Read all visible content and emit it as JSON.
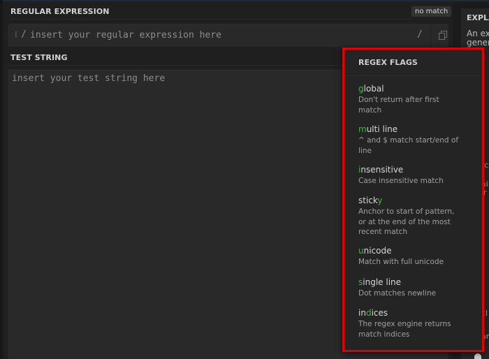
{
  "regex": {
    "label": "REGULAR EXPRESSION",
    "match_status": "no match",
    "open_delimiter": "/",
    "close_delimiter": "/",
    "flags_indicator": "⁝",
    "placeholder": "insert your regular expression here",
    "value": "",
    "copy_icon": "copy-icon"
  },
  "test_string": {
    "label": "TEST STRING",
    "placeholder": "insert your test string here",
    "value": ""
  },
  "explanation": {
    "title": "EXPLANATION",
    "text_line1": "An ex",
    "text_line2": "gener",
    "fragments": [
      "rc",
      "ai",
      "ır",
      "cl",
      "ar"
    ]
  },
  "flags_menu": {
    "title": "REGEX FLAGS",
    "highlight_color": "#4caf50",
    "items": [
      {
        "pre": "",
        "key": "g",
        "post": "lobal",
        "description": "Don't return after first match"
      },
      {
        "pre": "",
        "key": "m",
        "post": "ulti line",
        "description": "^ and $ match start/end of line"
      },
      {
        "pre": "",
        "key": "i",
        "post": "nsensitive",
        "description": "Case insensitive match"
      },
      {
        "pre": "stick",
        "key": "y",
        "post": "",
        "description": "Anchor to start of pattern, or at the end of the most recent match"
      },
      {
        "pre": "",
        "key": "u",
        "post": "nicode",
        "description": "Match with full unicode"
      },
      {
        "pre": "",
        "key": "s",
        "post": "ingle line",
        "description": "Dot matches newline"
      },
      {
        "pre": "in",
        "key": "d",
        "post": "ices",
        "description": "The regex engine returns match indices"
      }
    ]
  }
}
